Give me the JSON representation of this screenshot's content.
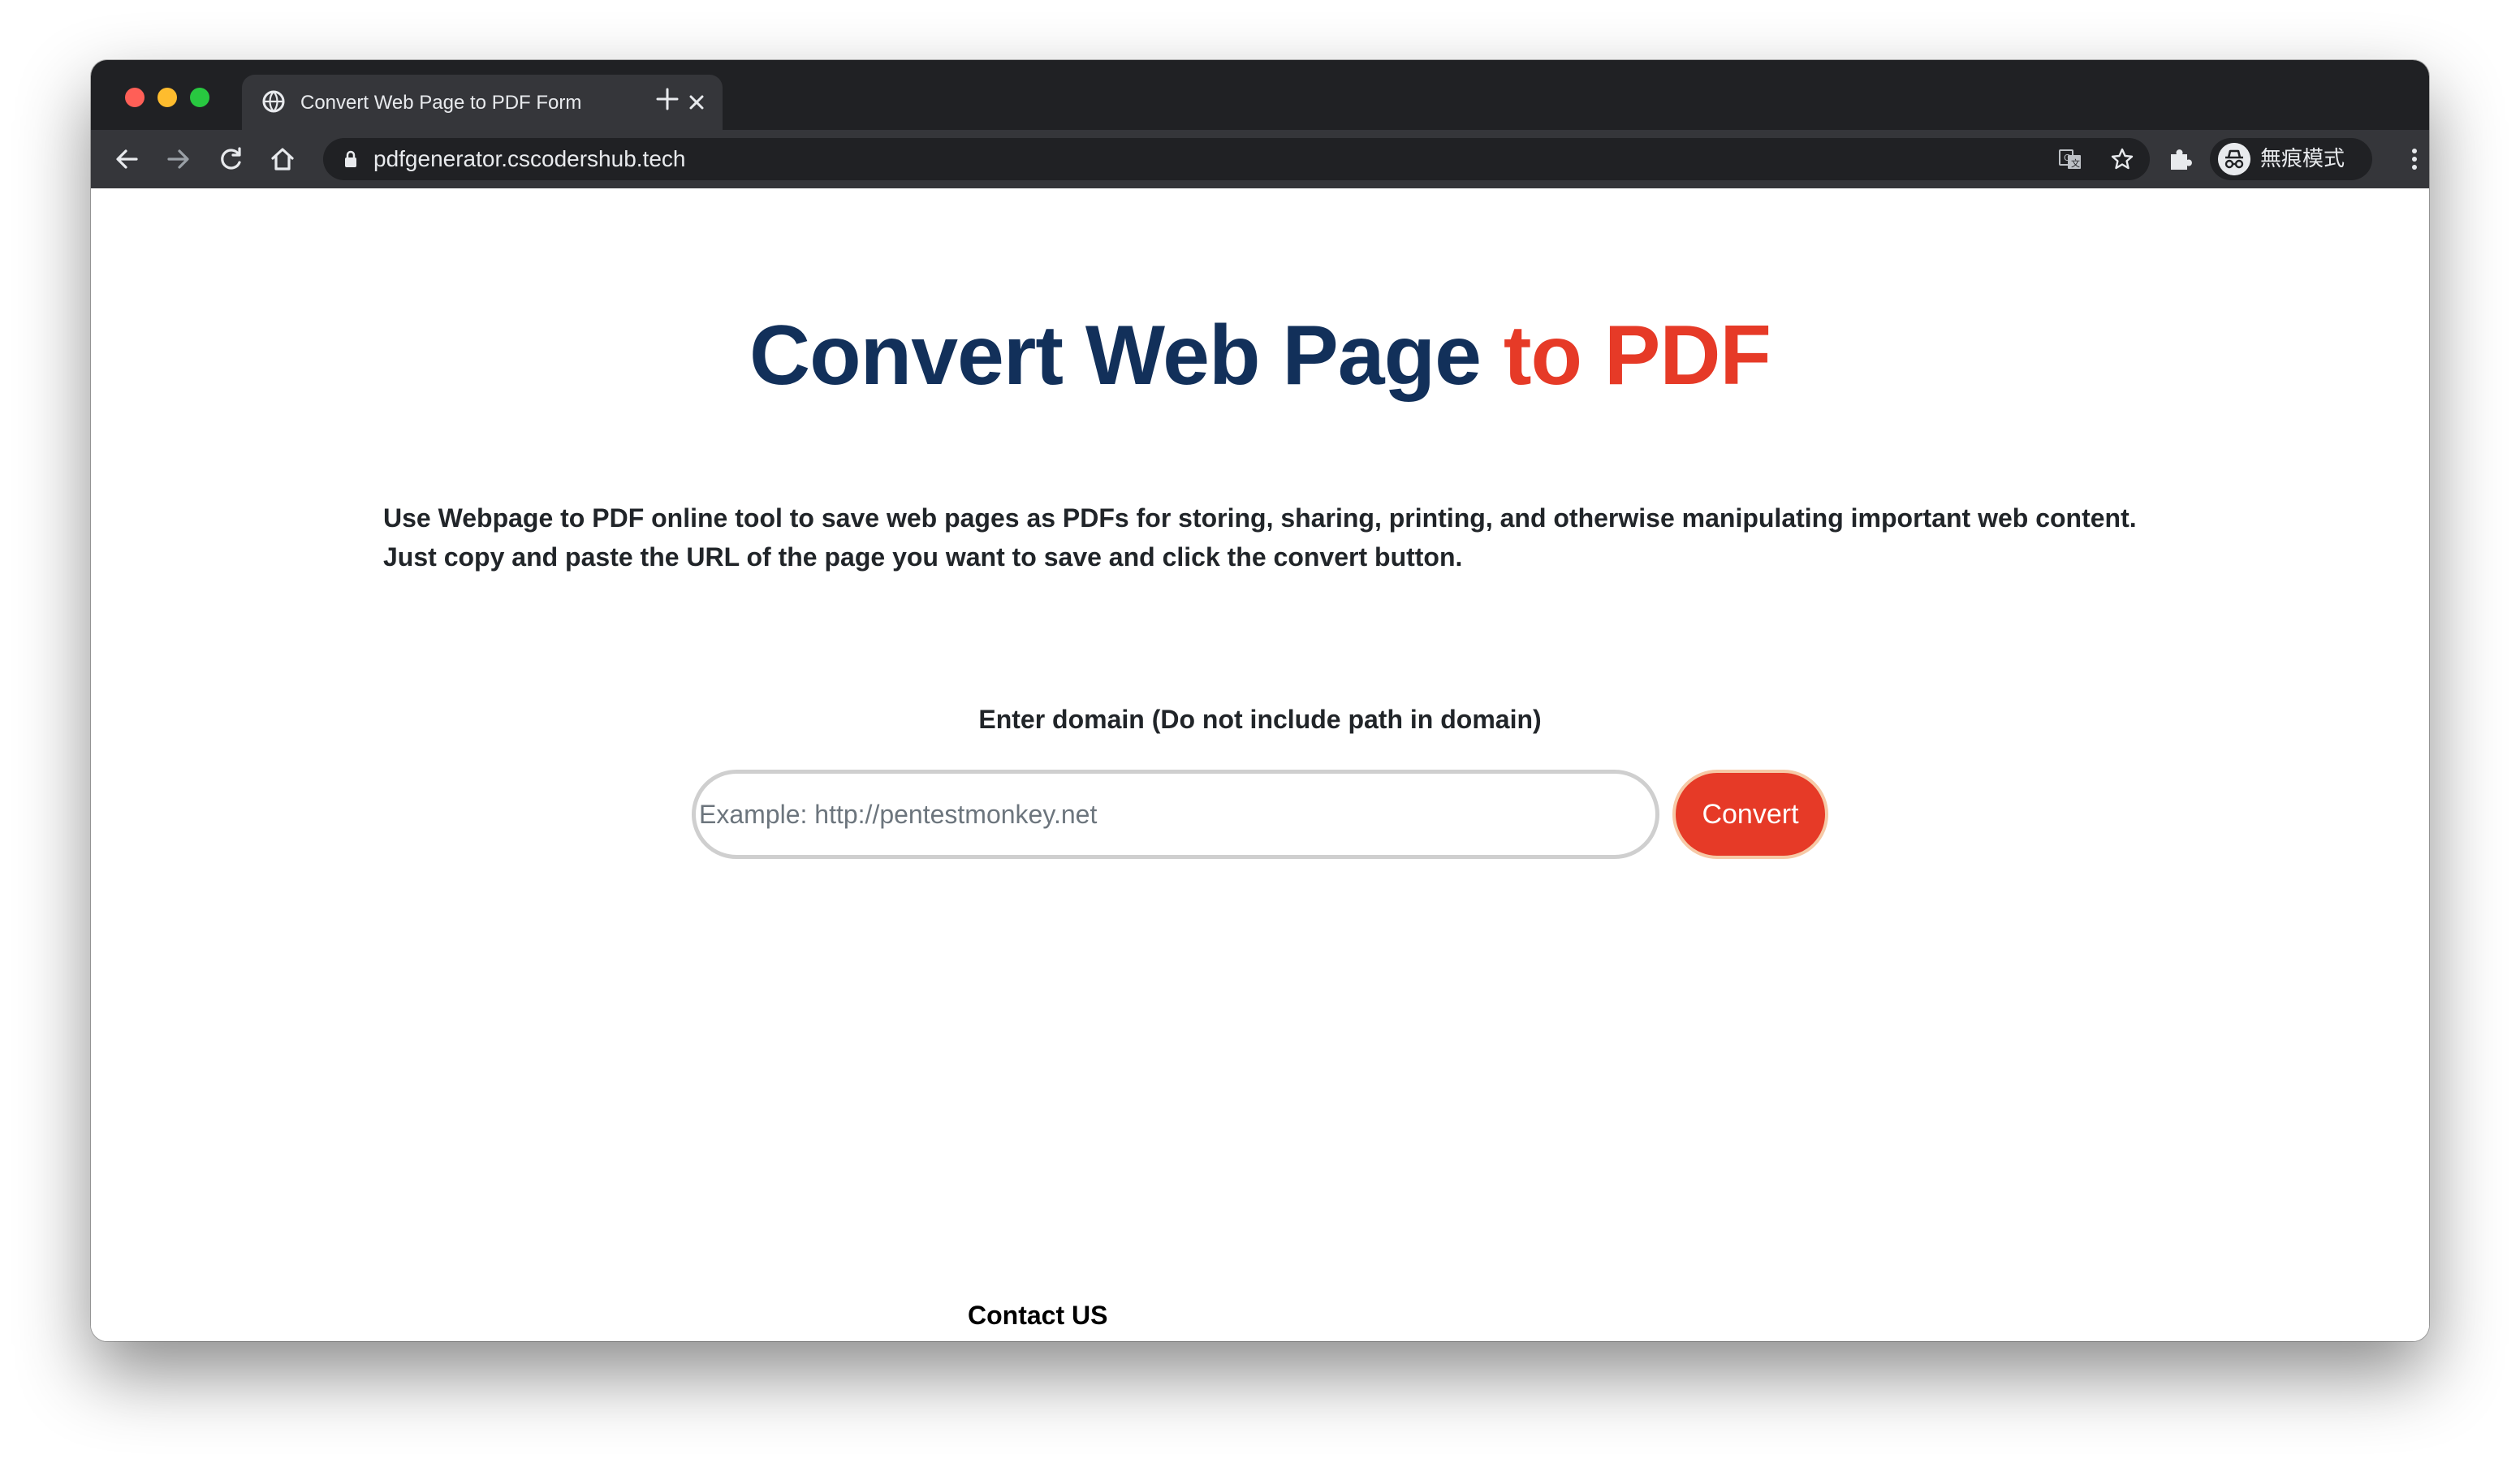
{
  "browser": {
    "tab_title": "Convert Web Page to PDF Form",
    "url": "pdfgenerator.cscodershub.tech",
    "profile_label": "無痕模式"
  },
  "page": {
    "headline_main": "Convert Web Page ",
    "headline_accent": "to PDF",
    "intro": "Use Webpage to PDF online tool to save web pages as PDFs for storing, sharing, printing, and otherwise manipulating important web content. Just copy and paste the URL of the page you want to save and click the convert button.",
    "form_label": "Enter domain (Do not include path in domain)",
    "input_placeholder": "Example: http://pentestmonkey.net",
    "input_value": "",
    "convert_label": "Convert",
    "contact_label": "Contact US"
  },
  "colors": {
    "headline_main": "#12305a",
    "accent": "#e63a27",
    "chrome_dark": "#202124",
    "chrome_tab": "#35363a"
  },
  "icons": {
    "tab_favicon": "globe-icon",
    "tab_close": "close-icon",
    "new_tab": "plus-icon",
    "back": "arrow-left-icon",
    "forward": "arrow-right-icon",
    "reload": "reload-icon",
    "home": "home-icon",
    "lock": "lock-icon",
    "translate": "translate-icon",
    "bookmark": "star-icon",
    "extensions": "puzzle-icon",
    "incognito": "incognito-icon",
    "menu": "kebab-menu-icon"
  }
}
